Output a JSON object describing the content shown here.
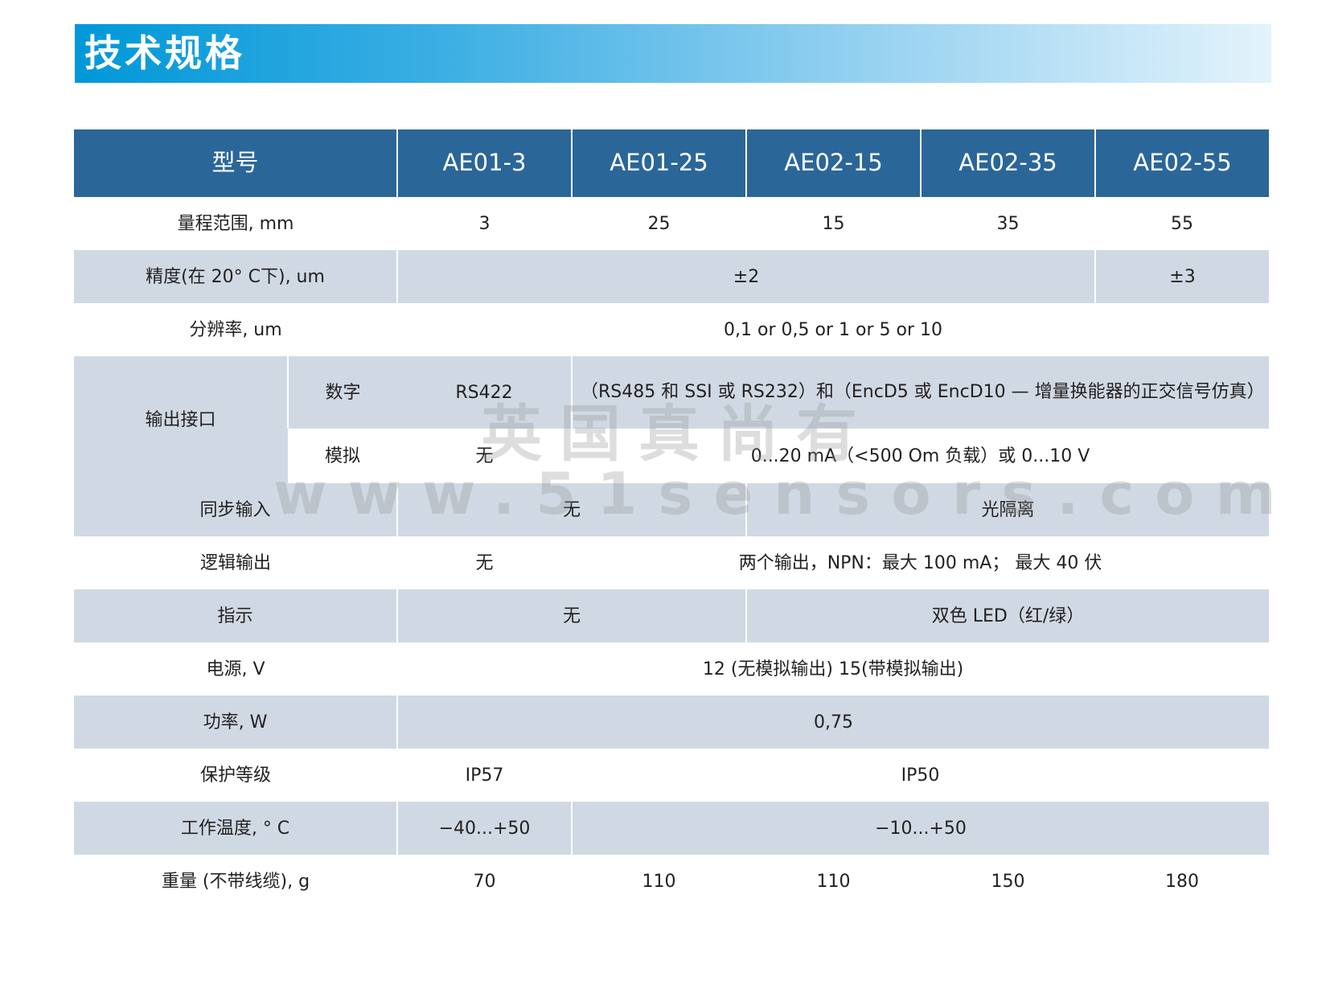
{
  "section_title": "技术规格",
  "header": {
    "model_label": "型号",
    "models": [
      "AE01-3",
      "AE01-25",
      "AE02-15",
      "AE02-35",
      "AE02-55"
    ]
  },
  "rows": {
    "range": {
      "label": "量程范围, mm",
      "values": [
        "3",
        "25",
        "15",
        "35",
        "55"
      ]
    },
    "accuracy": {
      "label": "精度(在 20°  C下), um",
      "value_a": "±2",
      "value_b": "±3"
    },
    "resolution": {
      "label": "分辨率, um",
      "value": "0,1 or 0,5 or 1 or 5 or 10"
    },
    "output": {
      "label": "输出接口",
      "digital_label": "数字",
      "digital_a": "RS422",
      "digital_b": "（RS485 和 SSI 或 RS232）和（EncD5 或 EncD10 — 增量换能器的正交信号仿真）",
      "analog_label": "模拟",
      "analog_a": "无",
      "analog_b": "0...20 mA（<500 Om 负载）或 0...10 V"
    },
    "sync": {
      "label": "同步输入",
      "value_a": "无",
      "value_b": "光隔离"
    },
    "logic": {
      "label": "逻辑输出",
      "value_a": "无",
      "value_b": "两个输出，NPN：最大 100 mA； 最大 40 伏"
    },
    "indication": {
      "label": "指示",
      "value_a": "无",
      "value_b": "双色 LED（红/绿）"
    },
    "power_supply": {
      "label": "电源, V",
      "value": "12 (无模拟输出) 15(带模拟输出)"
    },
    "power": {
      "label": "功率, W",
      "value": "0,75"
    },
    "protection": {
      "label": "保护等级",
      "value_a": "IP57",
      "value_b": "IP50"
    },
    "temperature": {
      "label": "工作温度, °  C",
      "value_a": "−40...+50",
      "value_b": "−10...+50"
    },
    "weight": {
      "label": "重量 (不带线缆), g",
      "values": [
        "70",
        "110",
        "110",
        "150",
        "180"
      ]
    }
  },
  "watermark": {
    "line1": "英国真尚有",
    "line2": "www.51sensors.com"
  },
  "colors": {
    "header_bg": "#2b6699",
    "shade_row": "#d0d9e3",
    "banner_start": "#0098d8",
    "banner_end": "#e3f3fb"
  }
}
